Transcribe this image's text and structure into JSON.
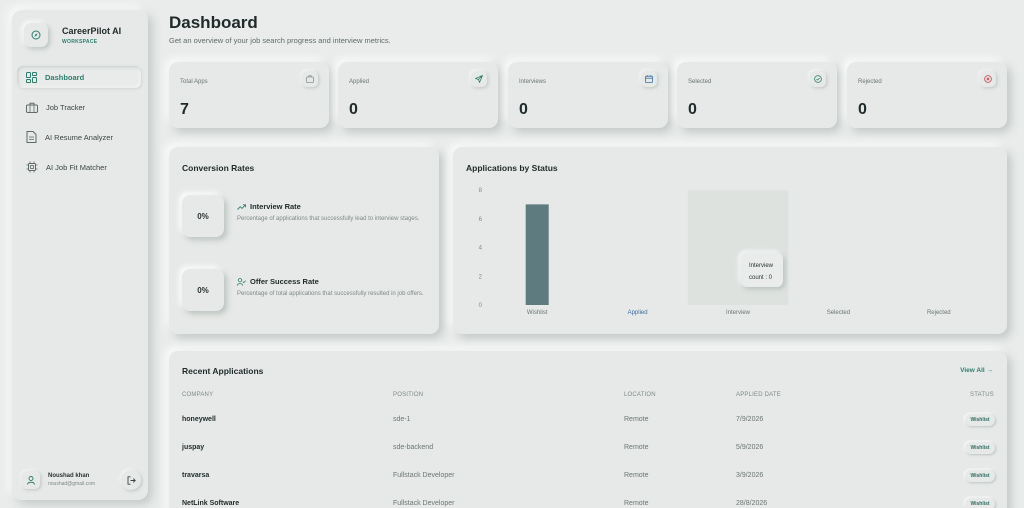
{
  "brand": {
    "name": "CareerPilot AI",
    "subtitle": "WORKSPACE"
  },
  "nav": [
    {
      "label": "Dashboard",
      "icon": "dashboard-icon",
      "active": true
    },
    {
      "label": "Job Tracker",
      "icon": "briefcase-icon",
      "active": false
    },
    {
      "label": "AI Resume Analyzer",
      "icon": "document-icon",
      "active": false
    },
    {
      "label": "AI Job Fit Matcher",
      "icon": "chip-icon",
      "active": false
    }
  ],
  "user": {
    "name": "Noushad khan",
    "email": "noushad@gmail.com"
  },
  "header": {
    "title": "Dashboard",
    "subtitle": "Get an overview of your job search progress and interview metrics."
  },
  "stats": [
    {
      "label": "Total Apps",
      "value": "7",
      "icon": "briefcase-icon",
      "color": "#8a9593"
    },
    {
      "label": "Applied",
      "value": "0",
      "icon": "send-icon",
      "color": "#2f7d6d"
    },
    {
      "label": "Interviews",
      "value": "0",
      "icon": "calendar-icon",
      "color": "#3d6fa0"
    },
    {
      "label": "Selected",
      "value": "0",
      "icon": "check-circle-icon",
      "color": "#2f7d6d"
    },
    {
      "label": "Rejected",
      "value": "0",
      "icon": "x-circle-icon",
      "color": "#c0464c"
    }
  ],
  "conversion": {
    "title": "Conversion Rates",
    "interview": {
      "value": "0%",
      "title": "Interview Rate",
      "desc": "Percentage of applications that successfully lead to interview stages."
    },
    "offer": {
      "value": "0%",
      "title": "Offer Success Rate",
      "desc": "Percentage of total applications that successfully resulted in job offers."
    }
  },
  "status_chart": {
    "title": "Applications by Status",
    "tooltip": {
      "line1": "Interview",
      "line2": "count : 0"
    }
  },
  "chart_data": {
    "type": "bar",
    "title": "Applications by Status",
    "categories": [
      "Wishlist",
      "Applied",
      "Interview",
      "Selected",
      "Rejected"
    ],
    "values": [
      7,
      0,
      0,
      0,
      0
    ],
    "yticks": [
      "8",
      "6",
      "4",
      "2",
      "0"
    ],
    "ylim": [
      0,
      8
    ],
    "bar_color": "#5e7b80",
    "grid": false,
    "highlight_category": "Interview"
  },
  "recent": {
    "title": "Recent Applications",
    "view_all": "View All →",
    "columns": {
      "company": "COMPANY",
      "position": "POSITION",
      "location": "LOCATION",
      "date": "APPLIED DATE",
      "status": "STATUS"
    },
    "rows": [
      {
        "company": "honeywell",
        "position": "sde-1",
        "location": "Remote",
        "date": "7/9/2026",
        "status": "Wishlist"
      },
      {
        "company": "juspay",
        "position": "sde-backend",
        "location": "Remote",
        "date": "5/9/2026",
        "status": "Wishlist"
      },
      {
        "company": "travarsa",
        "position": "Fullstack Developer",
        "location": "Remote",
        "date": "3/9/2026",
        "status": "Wishlist"
      },
      {
        "company": "NetLink Software",
        "position": "Fullstack Developer",
        "location": "Remote",
        "date": "28/8/2026",
        "status": "Wishlist"
      }
    ]
  },
  "colors": {
    "accent": "#2f7d6d",
    "background": "#e9ecea",
    "rejected": "#c0464c"
  }
}
